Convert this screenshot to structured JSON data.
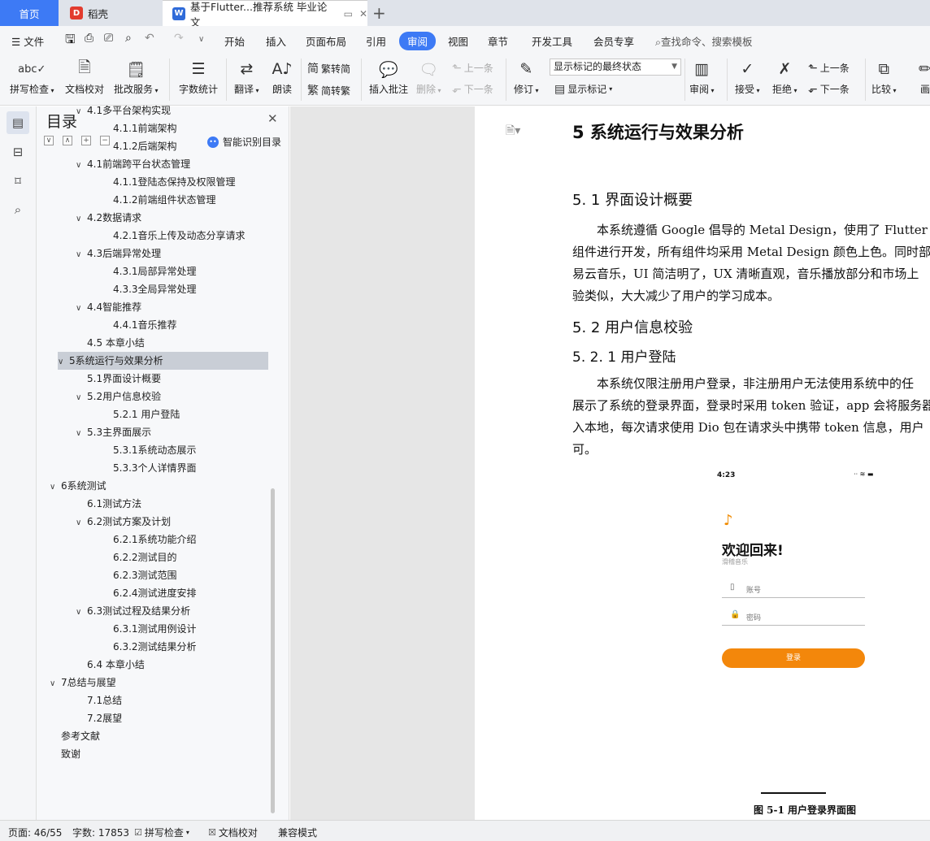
{
  "tabs": {
    "home": "首页",
    "daoke": "稻壳",
    "doc": "基于Flutter...推荐系统 毕业论文",
    "new_tab": "+"
  },
  "menu": {
    "file": "文件",
    "items": [
      "开始",
      "插入",
      "页面布局",
      "引用",
      "审阅",
      "视图",
      "章节",
      "开发工具",
      "会员专享"
    ],
    "active": "审阅",
    "search": "查找命令、搜索模板"
  },
  "ribbon": {
    "spell": "拼写检查",
    "doc_check": "文档校对",
    "approve": "批改服务",
    "word_count": "字数统计",
    "translate": "翻译",
    "read": "朗读",
    "to_trad": "繁转简",
    "to_simp": "简转繁",
    "insert_comment": "插入批注",
    "delete": "删除",
    "prev": "上一条",
    "next": "下一条",
    "revise": "修订",
    "markup_mode": "显示标记的最终状态",
    "show_markup": "显示标记",
    "review": "审阅",
    "accept": "接受",
    "reject": "拒绝",
    "prev2": "上一条",
    "next2": "下一条",
    "compare": "比较",
    "draw": "画"
  },
  "toc": {
    "title": "目录",
    "smart": "智能识别目录",
    "items": [
      {
        "text": "4.1多平台架构实现",
        "level": 2,
        "arrow": "∨"
      },
      {
        "text": "4.1.1前端架构",
        "level": 3
      },
      {
        "text": "4.1.2后端架构",
        "level": 3
      },
      {
        "text": "4.1前端跨平台状态管理",
        "level": 2,
        "arrow": "∨"
      },
      {
        "text": "4.1.1登陆态保持及权限管理",
        "level": 3
      },
      {
        "text": "4.1.2前端组件状态管理",
        "level": 3
      },
      {
        "text": "4.2数据请求",
        "level": 2,
        "arrow": "∨"
      },
      {
        "text": "4.2.1音乐上传及动态分享请求",
        "level": 3
      },
      {
        "text": "4.3后端异常处理",
        "level": 2,
        "arrow": "∨"
      },
      {
        "text": "4.3.1局部异常处理",
        "level": 3
      },
      {
        "text": "4.3.3全局异常处理",
        "level": 3
      },
      {
        "text": "4.4智能推荐",
        "level": 2,
        "arrow": "∨"
      },
      {
        "text": "4.4.1音乐推荐",
        "level": 3
      },
      {
        "text": "4.5 本章小结",
        "level": 2
      },
      {
        "text": "5系统运行与效果分析",
        "level": 1,
        "arrow": "∨",
        "selected": true
      },
      {
        "text": "5.1界面设计概要",
        "level": 2
      },
      {
        "text": "5.2用户信息校验",
        "level": 2,
        "arrow": "∨"
      },
      {
        "text": "5.2.1 用户登陆",
        "level": 3
      },
      {
        "text": "5.3主界面展示",
        "level": 2,
        "arrow": "∨"
      },
      {
        "text": "5.3.1系统动态展示",
        "level": 3
      },
      {
        "text": "5.3.3个人详情界面",
        "level": 3
      },
      {
        "text": "6系统测试",
        "level": 1,
        "arrow": "∨"
      },
      {
        "text": "6.1测试方法",
        "level": 2
      },
      {
        "text": "6.2测试方案及计划",
        "level": 2,
        "arrow": "∨"
      },
      {
        "text": "6.2.1系统功能介绍",
        "level": 3
      },
      {
        "text": "6.2.2测试目的",
        "level": 3
      },
      {
        "text": "6.2.3测试范围",
        "level": 3
      },
      {
        "text": "6.2.4测试进度安排",
        "level": 3
      },
      {
        "text": "6.3测试过程及结果分析",
        "level": 2,
        "arrow": "∨"
      },
      {
        "text": "6.3.1测试用例设计",
        "level": 3
      },
      {
        "text": "6.3.2测试结果分析",
        "level": 3
      },
      {
        "text": "6.4 本章小结",
        "level": 2
      },
      {
        "text": "7总结与展望",
        "level": 1,
        "arrow": "∨"
      },
      {
        "text": "7.1总结",
        "level": 2
      },
      {
        "text": "7.2展望",
        "level": 2
      },
      {
        "text": "参考文献",
        "level": 1
      },
      {
        "text": "致谢",
        "level": 1
      }
    ]
  },
  "doc": {
    "h1": "5  系统运行与效果分析",
    "h2a": "5. 1  界面设计概要",
    "p1": [
      "本系统遵循 Google 倡导的 Metal Design，使用了 Flutter 原生",
      "组件进行开发，所有组件均采用 Metal Design 颜色上色。同时部",
      "易云音乐，UI 简洁明了，UX 清晰直观，音乐播放部分和市场上",
      "验类似，大大减少了用户的学习成本。"
    ],
    "h2b": "5. 2  用户信息校验",
    "h3": "5. 2. 1  用户登陆",
    "p2": [
      "本系统仅限注册用户登录，非注册用户无法使用系统中的任",
      "展示了系统的登录界面，登录时采用 token 验证，app 会将服务器",
      "入本地，每次请求使用 Dio 包在请求头中携带 token 信息，用户",
      "可。"
    ],
    "phone": {
      "time": "4:23",
      "welcome": "欢迎回来!",
      "app_name": "滑稽音乐",
      "account": "账号",
      "password": "密码",
      "login": "登录"
    },
    "caption": "图 5-1 用户登录界面图"
  },
  "status": {
    "page": "页面: 46/55",
    "words": "字数: 17853",
    "spell": "拼写检查",
    "doc_check": "文档校对",
    "compat": "兼容模式"
  }
}
